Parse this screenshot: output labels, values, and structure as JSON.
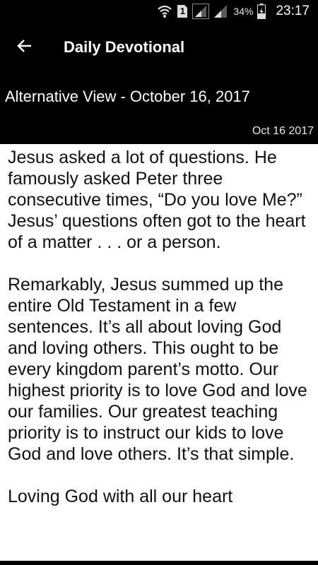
{
  "status_bar": {
    "battery_percent": "34%",
    "time": "23:17",
    "sim_label": "1",
    "icons": [
      "wifi-icon",
      "sim-card-icon",
      "signal-icon",
      "signal-icon-secondary",
      "battery-charging-icon"
    ]
  },
  "app_bar": {
    "back_icon": "arrow-left-icon",
    "title": "Daily Devotional"
  },
  "header": {
    "subtitle": "Alternative View - October 16, 2017",
    "date": "Oct 16 2017"
  },
  "content": {
    "paragraphs": [
      "Jesus asked a lot of questions. He famously asked Peter three consecutive times, “Do you love Me?” Jesus’ questions often got to the heart of a matter . . . or a person.",
      "Remarkably, Jesus summed up the entire Old Testament in a few sentences. It’s all about loving God and loving others. This ought to be every kingdom parent’s motto. Our highest priority is to love God and love our families. Our greatest teaching priority is to instruct our kids to love God and love others. It’s that simple.",
      "Loving God with all our heart"
    ]
  },
  "colors": {
    "header_background": "#000000",
    "header_text": "#ffffff",
    "body_background": "#ffffff",
    "body_text": "#111111"
  }
}
